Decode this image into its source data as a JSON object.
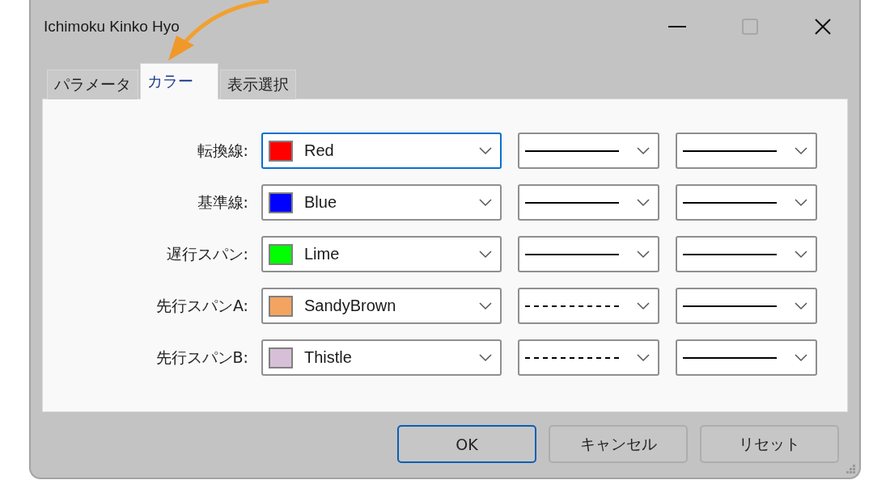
{
  "window": {
    "title": "Ichimoku Kinko Hyo",
    "maximize_disabled": true
  },
  "tabs": [
    {
      "label": "パラメータ",
      "selected": false
    },
    {
      "label": "カラー",
      "selected": true
    },
    {
      "label": "表示選択",
      "selected": false
    }
  ],
  "rows": [
    {
      "label": "転換線:",
      "color_name": "Red",
      "color": "#ff0000",
      "focused": true,
      "line": {
        "kind": "solid"
      }
    },
    {
      "label": "基準線:",
      "color_name": "Blue",
      "color": "#0000ff",
      "focused": false,
      "line": {
        "kind": "solid"
      }
    },
    {
      "label": "遅行スパン:",
      "color_name": "Lime",
      "color": "#00ff00",
      "focused": false,
      "line": {
        "kind": "solid"
      }
    },
    {
      "label": "先行スパンA:",
      "color_name": "SandyBrown",
      "color": "#f4a460",
      "focused": false,
      "line": {
        "kind": "dashed"
      }
    },
    {
      "label": "先行スパンB:",
      "color_name": "Thistle",
      "color": "#d8bfd8",
      "focused": false,
      "line": {
        "kind": "dashed"
      }
    }
  ],
  "buttons": [
    {
      "label": "OK",
      "default": true
    },
    {
      "label": "キャンセル",
      "default": false
    },
    {
      "label": "リセット",
      "default": false
    }
  ]
}
